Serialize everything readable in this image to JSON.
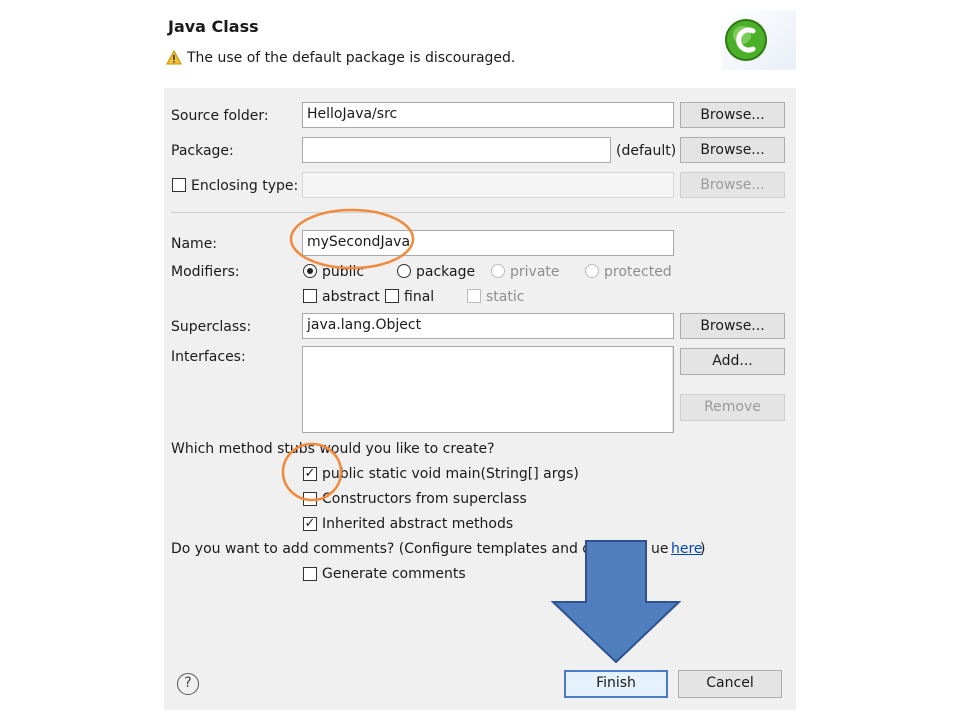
{
  "header": {
    "title": "Java Class",
    "warning": "The use of the default package is discouraged."
  },
  "form": {
    "source_folder": {
      "label": "Source folder:",
      "value": "HelloJava/src",
      "browse": "Browse..."
    },
    "package": {
      "label": "Package:",
      "value": "",
      "default_note": "(default)",
      "browse": "Browse..."
    },
    "enclosing_type": {
      "label": "Enclosing type:",
      "checked": false,
      "value": "",
      "browse": "Browse..."
    },
    "name": {
      "label": "Name:",
      "value": "mySecondJava"
    },
    "modifiers": {
      "label": "Modifiers:",
      "access": [
        "public",
        "package",
        "private",
        "protected"
      ],
      "selected": "public",
      "abstract": "abstract",
      "final": "final",
      "static": "static"
    },
    "superclass": {
      "label": "Superclass:",
      "value": "java.lang.Object",
      "browse": "Browse..."
    },
    "interfaces": {
      "label": "Interfaces:",
      "add": "Add...",
      "remove": "Remove"
    },
    "stubs": {
      "question": "Which method stubs would you like to create?",
      "main": {
        "label": "public static void main(String[] args)",
        "checked": true
      },
      "constructors": {
        "label": "Constructors from superclass",
        "checked": false
      },
      "inherited": {
        "label": "Inherited abstract methods",
        "checked": true
      }
    },
    "comments": {
      "question_a": "Do you want to add comments? (Configure templates and d",
      "question_b": "ue",
      "link": "here",
      "close_paren": ")",
      "generate": {
        "label": "Generate comments",
        "checked": false
      }
    }
  },
  "footer": {
    "help": "?",
    "finish": "Finish",
    "cancel": "Cancel"
  },
  "colors": {
    "annotation_circle": "#f08a3c",
    "annotation_arrow": "#4f7fbf",
    "arrow_stroke": "#2f528f"
  }
}
